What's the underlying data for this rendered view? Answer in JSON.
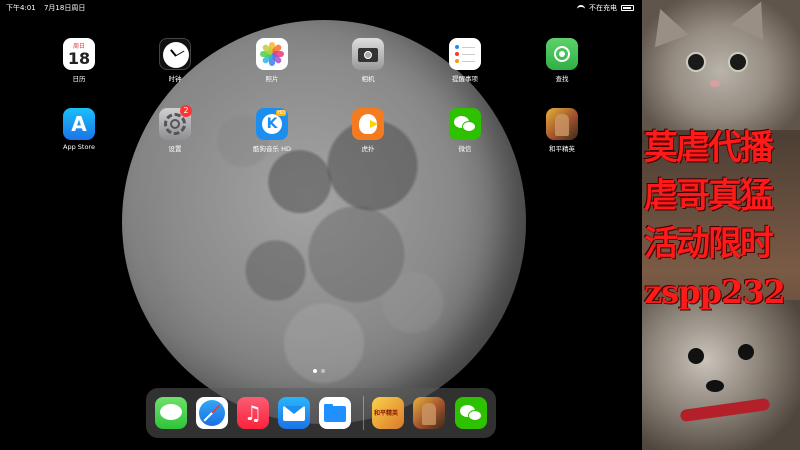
{
  "status_bar": {
    "time": "下午4:01",
    "date": "7月18日周日",
    "charging": "不在充电"
  },
  "apps": [
    {
      "label": "日历",
      "icon": "calendar-icon",
      "weekday": "周日",
      "day": "18"
    },
    {
      "label": "时钟",
      "icon": "clock-icon"
    },
    {
      "label": "照片",
      "icon": "photos-icon"
    },
    {
      "label": "相机",
      "icon": "camera-icon"
    },
    {
      "label": "提醒事项",
      "icon": "reminders-icon"
    },
    {
      "label": "查找",
      "icon": "find-my-icon"
    },
    {
      "label": "App Store",
      "icon": "app-store-icon"
    },
    {
      "label": "设置",
      "icon": "settings-icon",
      "badge": "2"
    },
    {
      "label": "酷狗音乐 HD",
      "icon": "kugou-music-icon"
    },
    {
      "label": "虎扑",
      "icon": "hupu-icon"
    },
    {
      "label": "微信",
      "icon": "wechat-icon"
    },
    {
      "label": "和平精英",
      "icon": "peace-elite-icon"
    }
  ],
  "dock": [
    {
      "icon": "messages-icon"
    },
    {
      "icon": "safari-icon"
    },
    {
      "icon": "music-icon",
      "glyph": "♫"
    },
    {
      "icon": "mail-icon"
    },
    {
      "icon": "files-icon"
    },
    {
      "icon": "peace-elite-icon",
      "text": "和平精英"
    },
    {
      "icon": "peace-elite-alt-icon"
    },
    {
      "icon": "wechat-icon"
    }
  ],
  "page_indicator": {
    "pages": 2,
    "current": 1
  },
  "overlay": {
    "lines": [
      "莫虐代播",
      "虐哥真猛",
      "活动限时",
      "zspp232"
    ]
  },
  "colors": {
    "overlay_text": "#ff1a1a",
    "badge": "#ff3333"
  }
}
